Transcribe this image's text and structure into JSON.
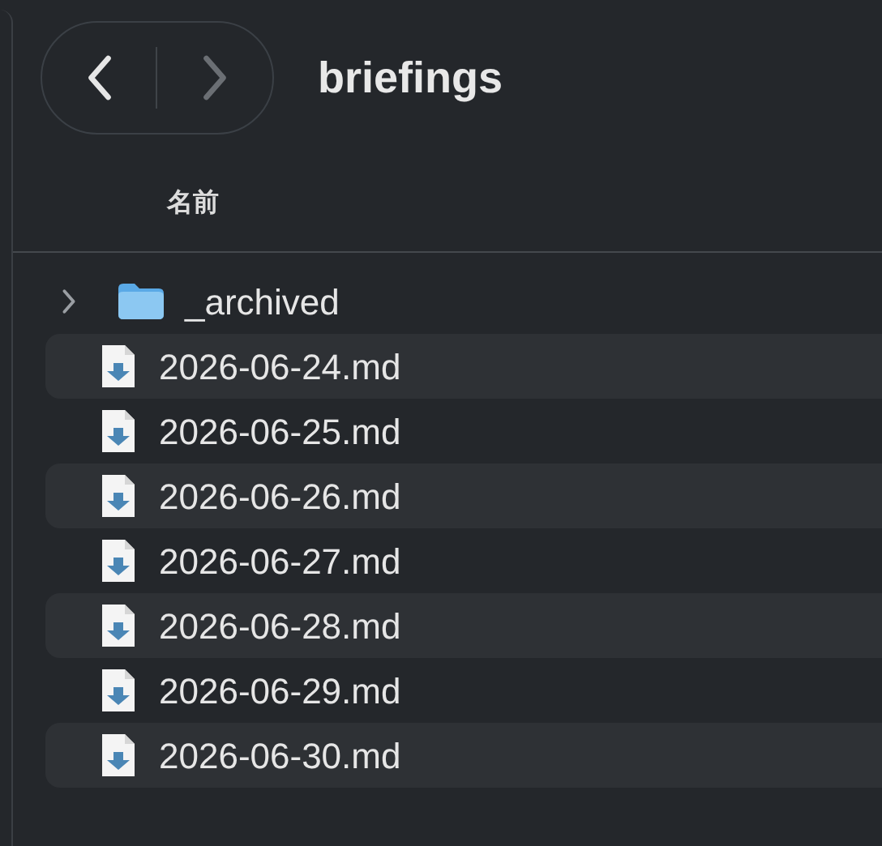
{
  "toolbar": {
    "back": {
      "disabled": false
    },
    "forward": {
      "disabled": true
    },
    "title": "briefings"
  },
  "columns": [
    {
      "label": "名前"
    }
  ],
  "items": [
    {
      "kind": "folder",
      "name": "_archived",
      "expanded": false
    },
    {
      "kind": "file",
      "name": "2026-06-24.md"
    },
    {
      "kind": "file",
      "name": "2026-06-25.md"
    },
    {
      "kind": "file",
      "name": "2026-06-26.md"
    },
    {
      "kind": "file",
      "name": "2026-06-27.md"
    },
    {
      "kind": "file",
      "name": "2026-06-28.md"
    },
    {
      "kind": "file",
      "name": "2026-06-29.md"
    },
    {
      "kind": "file",
      "name": "2026-06-30.md"
    }
  ]
}
